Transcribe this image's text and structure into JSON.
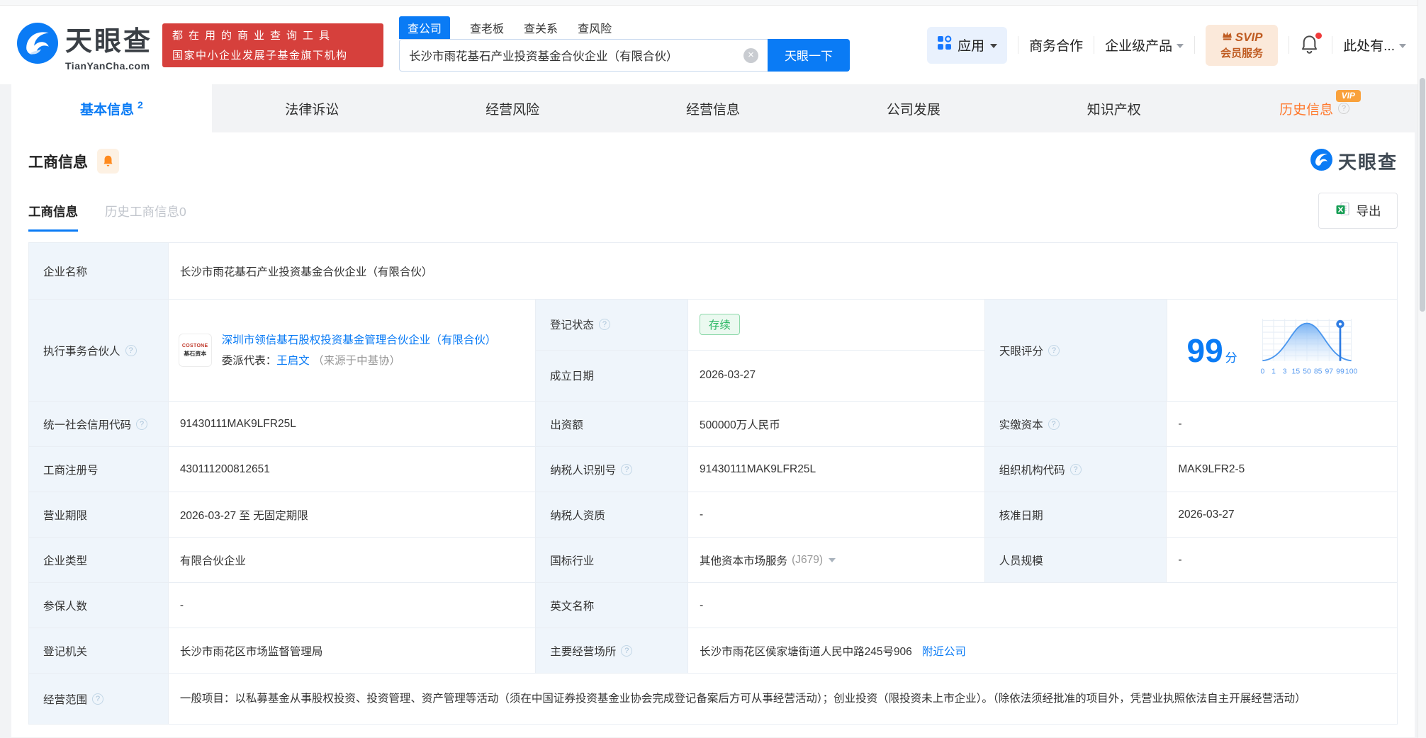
{
  "icons": {
    "help": "?",
    "clear": "×"
  },
  "header": {
    "brand": {
      "name": "天眼查",
      "domain": "TianYanCha.com"
    },
    "slogan": {
      "line1": "都在用的商业查询工具",
      "line2": "国家中小企业发展子基金旗下机构"
    },
    "search": {
      "tabs": [
        {
          "label": "查公司",
          "active": true
        },
        {
          "label": "查老板"
        },
        {
          "label": "查关系"
        },
        {
          "label": "查风险"
        }
      ],
      "value": "长沙市雨花基石产业投资基金合伙企业（有限合伙）",
      "button": "天眼一下"
    },
    "nav": {
      "apps": "应用",
      "cooperation": "商务合作",
      "enterprise": "企业级产品",
      "svip_line1": "SVIP",
      "svip_line2": "会员服务",
      "more": "此处有..."
    }
  },
  "tabs": [
    {
      "label": "基本信息",
      "badge": "2",
      "active": true
    },
    {
      "label": "法律诉讼"
    },
    {
      "label": "经营风险"
    },
    {
      "label": "经营信息"
    },
    {
      "label": "公司发展"
    },
    {
      "label": "知识产权"
    },
    {
      "label": "历史信息",
      "vip_tag": "VIP"
    }
  ],
  "section": {
    "title": "工商信息",
    "watermark": "天眼查",
    "subtabs": [
      {
        "label": "工商信息",
        "active": true
      },
      {
        "label": "历史工商信息0"
      }
    ],
    "export": "导出"
  },
  "table": {
    "company_name": {
      "label": "企业名称",
      "value": "长沙市雨花基石产业投资基金合伙企业（有限合伙）"
    },
    "partner": {
      "label": "执行事务合伙人",
      "logo_line1": "COSTONE",
      "logo_line2": "基石资本",
      "link": "深圳市领信基石股权投资基金管理合伙企业（有限合伙）",
      "rep_label": "委派代表：",
      "rep_name": "王启文",
      "rep_source": "（来源于中基协）"
    },
    "reg_status": {
      "label": "登记状态",
      "value": "存续"
    },
    "establish_date": {
      "label": "成立日期",
      "value": "2026-03-27"
    },
    "score": {
      "label": "天眼评分",
      "value": "99",
      "unit": "分"
    },
    "credit_code": {
      "label": "统一社会信用代码",
      "value": "91430111MAK9LFR25L"
    },
    "capital": {
      "label": "出资额",
      "value": "500000万人民币"
    },
    "paid_capital": {
      "label": "实缴资本",
      "value": "-"
    },
    "reg_number": {
      "label": "工商注册号",
      "value": "430111200812651"
    },
    "taxpayer_id": {
      "label": "纳税人识别号",
      "value": "91430111MAK9LFR25L"
    },
    "org_code": {
      "label": "组织机构代码",
      "value": "MAK9LFR2-5"
    },
    "business_term": {
      "label": "营业期限",
      "value": "2026-03-27 至 无固定期限"
    },
    "taxpayer_quality": {
      "label": "纳税人资质",
      "value": "-"
    },
    "approval_date": {
      "label": "核准日期",
      "value": "2026-03-27"
    },
    "company_type": {
      "label": "企业类型",
      "value": "有限合伙企业"
    },
    "industry": {
      "label": "国标行业",
      "value": "其他资本市场服务",
      "code": "(J679)"
    },
    "staff_size": {
      "label": "人员规模",
      "value": "-"
    },
    "insured_count": {
      "label": "参保人数",
      "value": "-"
    },
    "english_name": {
      "label": "英文名称",
      "value": "-"
    },
    "reg_authority": {
      "label": "登记机关",
      "value": "长沙市雨花区市场监督管理局"
    },
    "business_address": {
      "label": "主要经营场所",
      "value": "长沙市雨花区侯家塘街道人民中路245号906",
      "link": "附近公司"
    },
    "business_scope": {
      "label": "经营范围",
      "value": "一般项目：以私募基金从事股权投资、投资管理、资产管理等活动（须在中国证券投资基金业协会完成登记备案后方可从事经营活动）；创业投资（限投资未上市企业）。（除依法须经批准的项目外，凭营业执照依法自主开展经营活动）"
    }
  },
  "chart_data": {
    "type": "area",
    "title": "天眼评分分布曲线",
    "score": 99,
    "score_unit": "分",
    "x_ticks": [
      "0",
      "1",
      "3",
      "15",
      "50",
      "85",
      "97",
      "99",
      "100"
    ],
    "marker_at": "99",
    "curve_shape": "bell",
    "grid": true,
    "accent_color": "#0a7bf5"
  }
}
